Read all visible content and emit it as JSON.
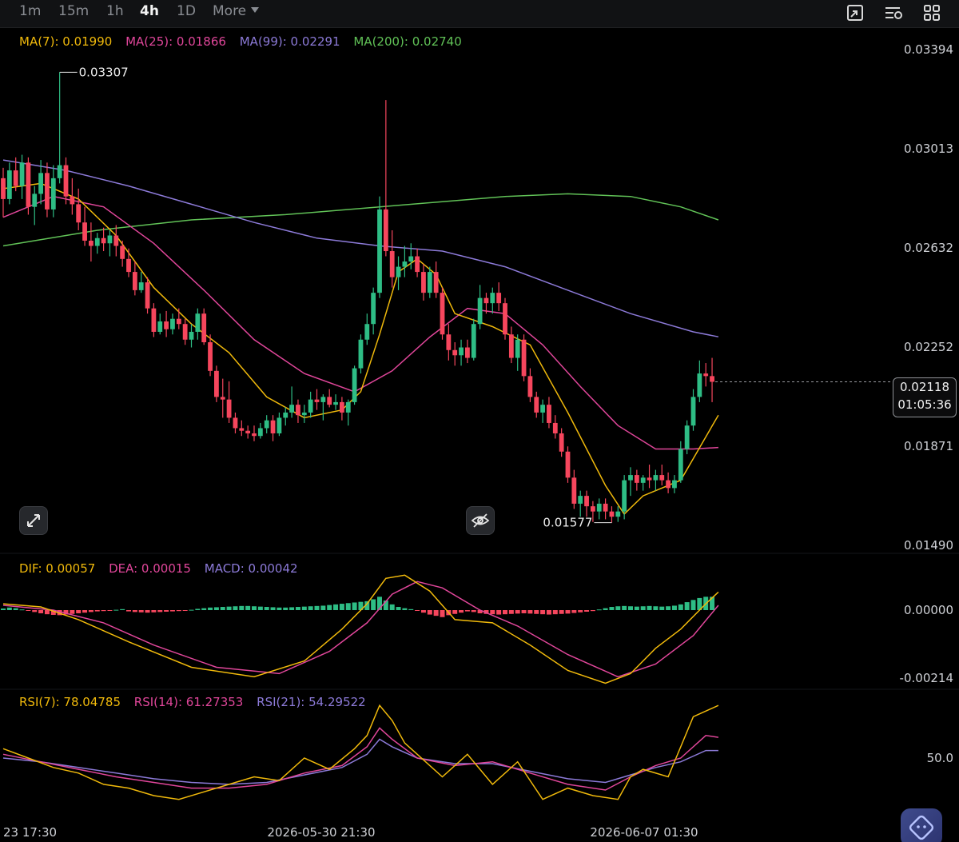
{
  "timeframes": [
    {
      "label": "1m",
      "active": false
    },
    {
      "label": "15m",
      "active": false
    },
    {
      "label": "1h",
      "active": false
    },
    {
      "label": "4h",
      "active": true
    },
    {
      "label": "1D",
      "active": false
    }
  ],
  "more_label": "More",
  "ma_legend": [
    {
      "label": "MA(7): 0.01990",
      "color": "#f0b90b"
    },
    {
      "label": "MA(25): 0.01866",
      "color": "#e0469a"
    },
    {
      "label": "MA(99): 0.02291",
      "color": "#8c7ad8"
    },
    {
      "label": "MA(200): 0.02740",
      "color": "#61c257"
    }
  ],
  "macd_legend": [
    {
      "label": "DIF: 0.00057",
      "color": "#f0b90b"
    },
    {
      "label": "DEA: 0.00015",
      "color": "#e0469a"
    },
    {
      "label": "MACD: 0.00042",
      "color": "#8c7ad8"
    }
  ],
  "rsi_legend": [
    {
      "label": "RSI(7): 78.04785",
      "color": "#f0b90b"
    },
    {
      "label": "RSI(14): 61.27353",
      "color": "#e0469a"
    },
    {
      "label": "RSI(21): 54.29522",
      "color": "#8c7ad8"
    }
  ],
  "current_price": {
    "price": "0.02118",
    "countdown": "01:05:36"
  },
  "colors": {
    "up": "#2ebd85",
    "down": "#f6465d",
    "ma7": "#f0b90b",
    "ma25": "#e0469a",
    "ma99": "#8c7ad8",
    "ma200": "#61c257",
    "axis_text": "#cfd1d6"
  },
  "icons": {
    "toolbar": [
      "fullscreen-box-icon",
      "indicator-settings-icon",
      "layout-grid-icon"
    ],
    "expand": "expand-arrows-icon",
    "hide": "eye-off-icon",
    "assistant": "ai-assistant-icon"
  },
  "chart_data": {
    "type": "candlestick",
    "price_axis": {
      "ticks": [
        0.03394,
        0.03013,
        0.02632,
        0.02252,
        0.01871,
        0.0149
      ],
      "labels": [
        "0.03394",
        "0.03013",
        "0.02632",
        "0.02252",
        "0.01871",
        "0.01490"
      ]
    },
    "annotations": {
      "high": {
        "value": 0.03307,
        "label": "0.03307"
      },
      "low": {
        "value": 0.01577,
        "label": "0.01577"
      }
    },
    "time_labels": [
      "23 17:30",
      "2026-05-30 21:30",
      "2026-06-07 01:30"
    ],
    "candles": [
      [
        0.029,
        0.0294,
        0.0275,
        0.0282
      ],
      [
        0.0282,
        0.0296,
        0.028,
        0.0293
      ],
      [
        0.0293,
        0.0298,
        0.0285,
        0.0287
      ],
      [
        0.0287,
        0.0299,
        0.0282,
        0.0296
      ],
      [
        0.0296,
        0.0298,
        0.0276,
        0.0279
      ],
      [
        0.0279,
        0.0287,
        0.0272,
        0.0284
      ],
      [
        0.0284,
        0.0297,
        0.028,
        0.0292
      ],
      [
        0.0292,
        0.0296,
        0.0275,
        0.0278
      ],
      [
        0.0278,
        0.0295,
        0.0275,
        0.029
      ],
      [
        0.029,
        0.03307,
        0.0288,
        0.0295
      ],
      [
        0.0295,
        0.0298,
        0.028,
        0.0283
      ],
      [
        0.0283,
        0.029,
        0.0276,
        0.028
      ],
      [
        0.028,
        0.0286,
        0.027,
        0.0273
      ],
      [
        0.0273,
        0.0279,
        0.0264,
        0.0266
      ],
      [
        0.0266,
        0.0273,
        0.0258,
        0.0264
      ],
      [
        0.0264,
        0.0269,
        0.0261,
        0.0267
      ],
      [
        0.0267,
        0.0271,
        0.0262,
        0.0265
      ],
      [
        0.0265,
        0.027,
        0.026,
        0.0268
      ],
      [
        0.0268,
        0.0272,
        0.026,
        0.0264
      ],
      [
        0.0264,
        0.0266,
        0.0256,
        0.0259
      ],
      [
        0.0259,
        0.0263,
        0.0252,
        0.0254
      ],
      [
        0.0254,
        0.0258,
        0.0245,
        0.0247
      ],
      [
        0.0247,
        0.0254,
        0.0246,
        0.025
      ],
      [
        0.025,
        0.0252,
        0.0238,
        0.024
      ],
      [
        0.024,
        0.0242,
        0.0229,
        0.0231
      ],
      [
        0.0231,
        0.0238,
        0.023,
        0.0235
      ],
      [
        0.0235,
        0.0239,
        0.0229,
        0.0232
      ],
      [
        0.0232,
        0.0238,
        0.023,
        0.0236
      ],
      [
        0.0236,
        0.024,
        0.0232,
        0.0234
      ],
      [
        0.0234,
        0.0236,
        0.0226,
        0.0228
      ],
      [
        0.0228,
        0.0234,
        0.0225,
        0.0231
      ],
      [
        0.0231,
        0.024,
        0.0228,
        0.0238
      ],
      [
        0.0238,
        0.024,
        0.0226,
        0.0227
      ],
      [
        0.0227,
        0.023,
        0.0214,
        0.0216
      ],
      [
        0.0216,
        0.0218,
        0.0204,
        0.0206
      ],
      [
        0.0206,
        0.0213,
        0.0198,
        0.0205
      ],
      [
        0.0205,
        0.0212,
        0.0196,
        0.0198
      ],
      [
        0.0198,
        0.02,
        0.0192,
        0.0194
      ],
      [
        0.0194,
        0.0197,
        0.0191,
        0.0193
      ],
      [
        0.0193,
        0.0195,
        0.019,
        0.0192
      ],
      [
        0.0192,
        0.0195,
        0.0189,
        0.0191
      ],
      [
        0.0191,
        0.0196,
        0.019,
        0.0194
      ],
      [
        0.0194,
        0.0199,
        0.0192,
        0.0197
      ],
      [
        0.0197,
        0.0199,
        0.0189,
        0.0192
      ],
      [
        0.0192,
        0.02,
        0.0191,
        0.0198
      ],
      [
        0.0198,
        0.0202,
        0.0195,
        0.02
      ],
      [
        0.02,
        0.021,
        0.0198,
        0.0203
      ],
      [
        0.0203,
        0.0205,
        0.0196,
        0.0199
      ],
      [
        0.0199,
        0.0203,
        0.0196,
        0.02
      ],
      [
        0.02,
        0.0208,
        0.0198,
        0.0205
      ],
      [
        0.0205,
        0.0209,
        0.0201,
        0.0204
      ],
      [
        0.0204,
        0.0207,
        0.0197,
        0.0206
      ],
      [
        0.0206,
        0.0209,
        0.0202,
        0.0203
      ],
      [
        0.0203,
        0.0207,
        0.0201,
        0.0204
      ],
      [
        0.0204,
        0.0206,
        0.0197,
        0.02
      ],
      [
        0.02,
        0.0205,
        0.0195,
        0.0204
      ],
      [
        0.0204,
        0.0218,
        0.0203,
        0.0217
      ],
      [
        0.0217,
        0.023,
        0.0215,
        0.0228
      ],
      [
        0.0228,
        0.0238,
        0.0226,
        0.0234
      ],
      [
        0.0234,
        0.0248,
        0.023,
        0.0246
      ],
      [
        0.0246,
        0.0283,
        0.0244,
        0.0278
      ],
      [
        0.0278,
        0.032,
        0.026,
        0.0262
      ],
      [
        0.0262,
        0.027,
        0.0248,
        0.0252
      ],
      [
        0.0252,
        0.026,
        0.0247,
        0.0256
      ],
      [
        0.0256,
        0.0264,
        0.0252,
        0.0258
      ],
      [
        0.0258,
        0.0265,
        0.0255,
        0.026
      ],
      [
        0.026,
        0.0263,
        0.0252,
        0.0254
      ],
      [
        0.0254,
        0.0257,
        0.0243,
        0.0246
      ],
      [
        0.0246,
        0.0256,
        0.0244,
        0.0254
      ],
      [
        0.0254,
        0.0258,
        0.0244,
        0.0246
      ],
      [
        0.0246,
        0.0248,
        0.0228,
        0.023
      ],
      [
        0.023,
        0.0234,
        0.022,
        0.0224
      ],
      [
        0.0224,
        0.0227,
        0.0218,
        0.0222
      ],
      [
        0.0222,
        0.0228,
        0.0218,
        0.0225
      ],
      [
        0.0225,
        0.0228,
        0.0219,
        0.0221
      ],
      [
        0.0221,
        0.0236,
        0.022,
        0.0234
      ],
      [
        0.0234,
        0.0249,
        0.0232,
        0.0244
      ],
      [
        0.0244,
        0.0246,
        0.0238,
        0.0242
      ],
      [
        0.0242,
        0.0248,
        0.0238,
        0.0246
      ],
      [
        0.0246,
        0.025,
        0.0239,
        0.0242
      ],
      [
        0.0242,
        0.0244,
        0.0228,
        0.023
      ],
      [
        0.023,
        0.0233,
        0.0219,
        0.0221
      ],
      [
        0.0221,
        0.023,
        0.0216,
        0.0228
      ],
      [
        0.0228,
        0.023,
        0.0212,
        0.0214
      ],
      [
        0.0214,
        0.0217,
        0.0204,
        0.0206
      ],
      [
        0.0206,
        0.0208,
        0.0198,
        0.02
      ],
      [
        0.02,
        0.0205,
        0.0196,
        0.0203
      ],
      [
        0.0203,
        0.0206,
        0.0194,
        0.0196
      ],
      [
        0.0196,
        0.0199,
        0.019,
        0.0192
      ],
      [
        0.0192,
        0.0194,
        0.0183,
        0.0185
      ],
      [
        0.0185,
        0.0187,
        0.0173,
        0.0175
      ],
      [
        0.0175,
        0.0178,
        0.0163,
        0.0165
      ],
      [
        0.0165,
        0.017,
        0.016,
        0.0168
      ],
      [
        0.0168,
        0.017,
        0.016,
        0.0164
      ],
      [
        0.0164,
        0.0166,
        0.0158,
        0.0162
      ],
      [
        0.0162,
        0.0167,
        0.0159,
        0.0165
      ],
      [
        0.0165,
        0.0167,
        0.0159,
        0.0162
      ],
      [
        0.0162,
        0.0164,
        0.01577,
        0.016
      ],
      [
        0.016,
        0.0164,
        0.0158,
        0.0162
      ],
      [
        0.0162,
        0.0176,
        0.0159,
        0.0174
      ],
      [
        0.0174,
        0.0179,
        0.0168,
        0.0176
      ],
      [
        0.0176,
        0.0178,
        0.017,
        0.0173
      ],
      [
        0.0173,
        0.0176,
        0.017,
        0.0175
      ],
      [
        0.0175,
        0.018,
        0.0171,
        0.0174
      ],
      [
        0.0174,
        0.0178,
        0.017,
        0.0176
      ],
      [
        0.0176,
        0.018,
        0.0172,
        0.0174
      ],
      [
        0.0174,
        0.0177,
        0.0169,
        0.0171
      ],
      [
        0.0171,
        0.0176,
        0.0169,
        0.0174
      ],
      [
        0.0174,
        0.0189,
        0.0173,
        0.0186
      ],
      [
        0.0186,
        0.0197,
        0.0184,
        0.0195
      ],
      [
        0.0195,
        0.0209,
        0.0193,
        0.0206
      ],
      [
        0.0206,
        0.022,
        0.0204,
        0.0215
      ],
      [
        0.0215,
        0.0219,
        0.021,
        0.0214
      ],
      [
        0.0214,
        0.0221,
        0.0204,
        0.02118
      ]
    ],
    "ma_lines": {
      "ma7": {
        "x": [
          0,
          6,
          12,
          18,
          24,
          30,
          36,
          42,
          48,
          54,
          57,
          60,
          63,
          66,
          69,
          72,
          78,
          84,
          90,
          96,
          99,
          102,
          108,
          114
        ],
        "y": [
          0.0286,
          0.0288,
          0.0282,
          0.0268,
          0.0248,
          0.0234,
          0.0223,
          0.0206,
          0.0198,
          0.0201,
          0.0208,
          0.023,
          0.0254,
          0.0259,
          0.0253,
          0.0238,
          0.0233,
          0.0226,
          0.02,
          0.0172,
          0.0161,
          0.0168,
          0.0174,
          0.0199
        ]
      },
      "ma25": {
        "x": [
          0,
          8,
          16,
          24,
          32,
          40,
          48,
          56,
          62,
          68,
          74,
          80,
          86,
          92,
          98,
          104,
          110,
          114
        ],
        "y": [
          0.0275,
          0.0283,
          0.0279,
          0.0265,
          0.0247,
          0.0228,
          0.0215,
          0.0208,
          0.0216,
          0.0229,
          0.024,
          0.0238,
          0.0226,
          0.021,
          0.0195,
          0.0186,
          0.0186,
          0.01866
        ]
      },
      "ma99": {
        "x": [
          0,
          10,
          20,
          30,
          40,
          50,
          60,
          70,
          80,
          90,
          100,
          110,
          114
        ],
        "y": [
          0.0297,
          0.0293,
          0.0287,
          0.028,
          0.0273,
          0.0267,
          0.0264,
          0.0262,
          0.0256,
          0.0247,
          0.0238,
          0.0231,
          0.02291
        ]
      },
      "ma200": {
        "x": [
          0,
          15,
          30,
          45,
          60,
          70,
          80,
          90,
          100,
          108,
          114
        ],
        "y": [
          0.0264,
          0.027,
          0.0274,
          0.0276,
          0.0279,
          0.0281,
          0.0283,
          0.0284,
          0.0283,
          0.0279,
          0.0274
        ]
      }
    },
    "macd": {
      "axis_ticks": [
        0.0,
        -0.00214
      ],
      "axis_labels": [
        "0.00000",
        "-0.00214"
      ],
      "dif": {
        "x": [
          0,
          6,
          12,
          20,
          30,
          40,
          48,
          54,
          58,
          61,
          64,
          68,
          72,
          78,
          84,
          90,
          96,
          100,
          104,
          108,
          112,
          114
        ],
        "y": [
          0.0002,
          0.0001,
          -0.0003,
          -0.001,
          -0.0018,
          -0.0021,
          -0.0016,
          -0.0006,
          0.0002,
          0.001,
          0.0011,
          0.0006,
          -0.0003,
          -0.0004,
          -0.0011,
          -0.0019,
          -0.0023,
          -0.002,
          -0.0012,
          -0.0006,
          0.0002,
          0.00057
        ]
      },
      "dea": {
        "x": [
          0,
          8,
          16,
          24,
          34,
          44,
          52,
          58,
          62,
          66,
          70,
          76,
          82,
          90,
          98,
          104,
          110,
          114
        ],
        "y": [
          0.00015,
          0.0,
          -0.0004,
          -0.0011,
          -0.0018,
          -0.002,
          -0.0013,
          -0.0004,
          0.0005,
          0.0009,
          0.0007,
          0.0,
          -0.0005,
          -0.0014,
          -0.0021,
          -0.0017,
          -0.0008,
          0.00015
        ]
      },
      "histogram": [
        5e-05,
        8e-05,
        6e-05,
        2e-05,
        -2e-05,
        -6e-05,
        -0.0001,
        -0.00013,
        -0.00015,
        -0.00016,
        -0.00014,
        -0.00012,
        -0.0001,
        -8e-05,
        -6e-05,
        -4e-05,
        -3e-05,
        -2e-05,
        1e-05,
        3e-05,
        -4e-05,
        -6e-05,
        -7e-05,
        -8e-05,
        -7e-05,
        -6e-05,
        -5e-05,
        -4e-05,
        -3e-05,
        -2e-05,
        1e-05,
        4e-05,
        6e-05,
        8e-05,
        9e-05,
        0.0001,
        0.00011,
        0.00012,
        0.00013,
        0.00013,
        0.00012,
        0.00011,
        0.0001,
        9e-05,
        8e-05,
        8e-05,
        9e-05,
        0.0001,
        0.00011,
        0.00012,
        0.00013,
        0.00014,
        0.00016,
        0.00018,
        0.0002,
        0.00022,
        0.00024,
        0.00026,
        0.00028,
        0.00034,
        0.00042,
        0.0003,
        0.00018,
        0.0001,
        6e-05,
        3e-05,
        -2e-05,
        -8e-05,
        -0.00014,
        -0.00018,
        -0.00022,
        -0.00016,
        -0.00012,
        -8e-05,
        -4e-05,
        -6e-05,
        -0.0001,
        -0.00012,
        -0.00013,
        -0.00014,
        -0.00013,
        -0.00012,
        -0.00011,
        -0.0001,
        -0.00011,
        -0.00012,
        -0.00013,
        -0.00014,
        -0.00013,
        -0.00012,
        -0.00011,
        -9e-05,
        -7e-05,
        -5e-05,
        -3e-05,
        2e-05,
        6e-05,
        0.0001,
        0.00012,
        0.00013,
        0.00012,
        0.00011,
        0.00012,
        0.00013,
        0.00012,
        0.00011,
        0.00012,
        0.00014,
        0.00018,
        0.00025,
        0.00032,
        0.00038,
        0.00042,
        0.00042
      ]
    },
    "rsi": {
      "axis_ticks": [
        50.0
      ],
      "axis_labels": [
        "50.0"
      ],
      "rsi7": {
        "x": [
          0,
          4,
          8,
          12,
          16,
          20,
          24,
          28,
          32,
          36,
          40,
          44,
          48,
          52,
          56,
          58,
          60,
          62,
          64,
          66,
          70,
          74,
          78,
          82,
          86,
          90,
          94,
          98,
          100,
          102,
          106,
          110,
          114
        ],
        "y": [
          55,
          50,
          45,
          42,
          36,
          34,
          30,
          28,
          32,
          36,
          40,
          38,
          50,
          44,
          55,
          62,
          78,
          70,
          58,
          52,
          40,
          52,
          36,
          48,
          28,
          34,
          30,
          28,
          40,
          44,
          40,
          72,
          78
        ]
      },
      "rsi14": {
        "x": [
          0,
          6,
          12,
          18,
          24,
          30,
          36,
          42,
          48,
          54,
          58,
          60,
          62,
          66,
          72,
          78,
          84,
          90,
          96,
          100,
          104,
          108,
          112,
          114
        ],
        "y": [
          52,
          48,
          44,
          40,
          37,
          34,
          34,
          36,
          42,
          46,
          56,
          66,
          60,
          50,
          46,
          48,
          42,
          36,
          33,
          40,
          46,
          50,
          62,
          61
        ]
      },
      "rsi21": {
        "x": [
          0,
          6,
          12,
          18,
          24,
          30,
          36,
          42,
          48,
          54,
          58,
          60,
          62,
          66,
          72,
          78,
          84,
          90,
          96,
          100,
          104,
          108,
          112,
          114
        ],
        "y": [
          50,
          48,
          45,
          42,
          39,
          37,
          36,
          37,
          41,
          45,
          52,
          60,
          56,
          50,
          47,
          47,
          43,
          39,
          37,
          41,
          45,
          48,
          54,
          54
        ]
      }
    }
  }
}
